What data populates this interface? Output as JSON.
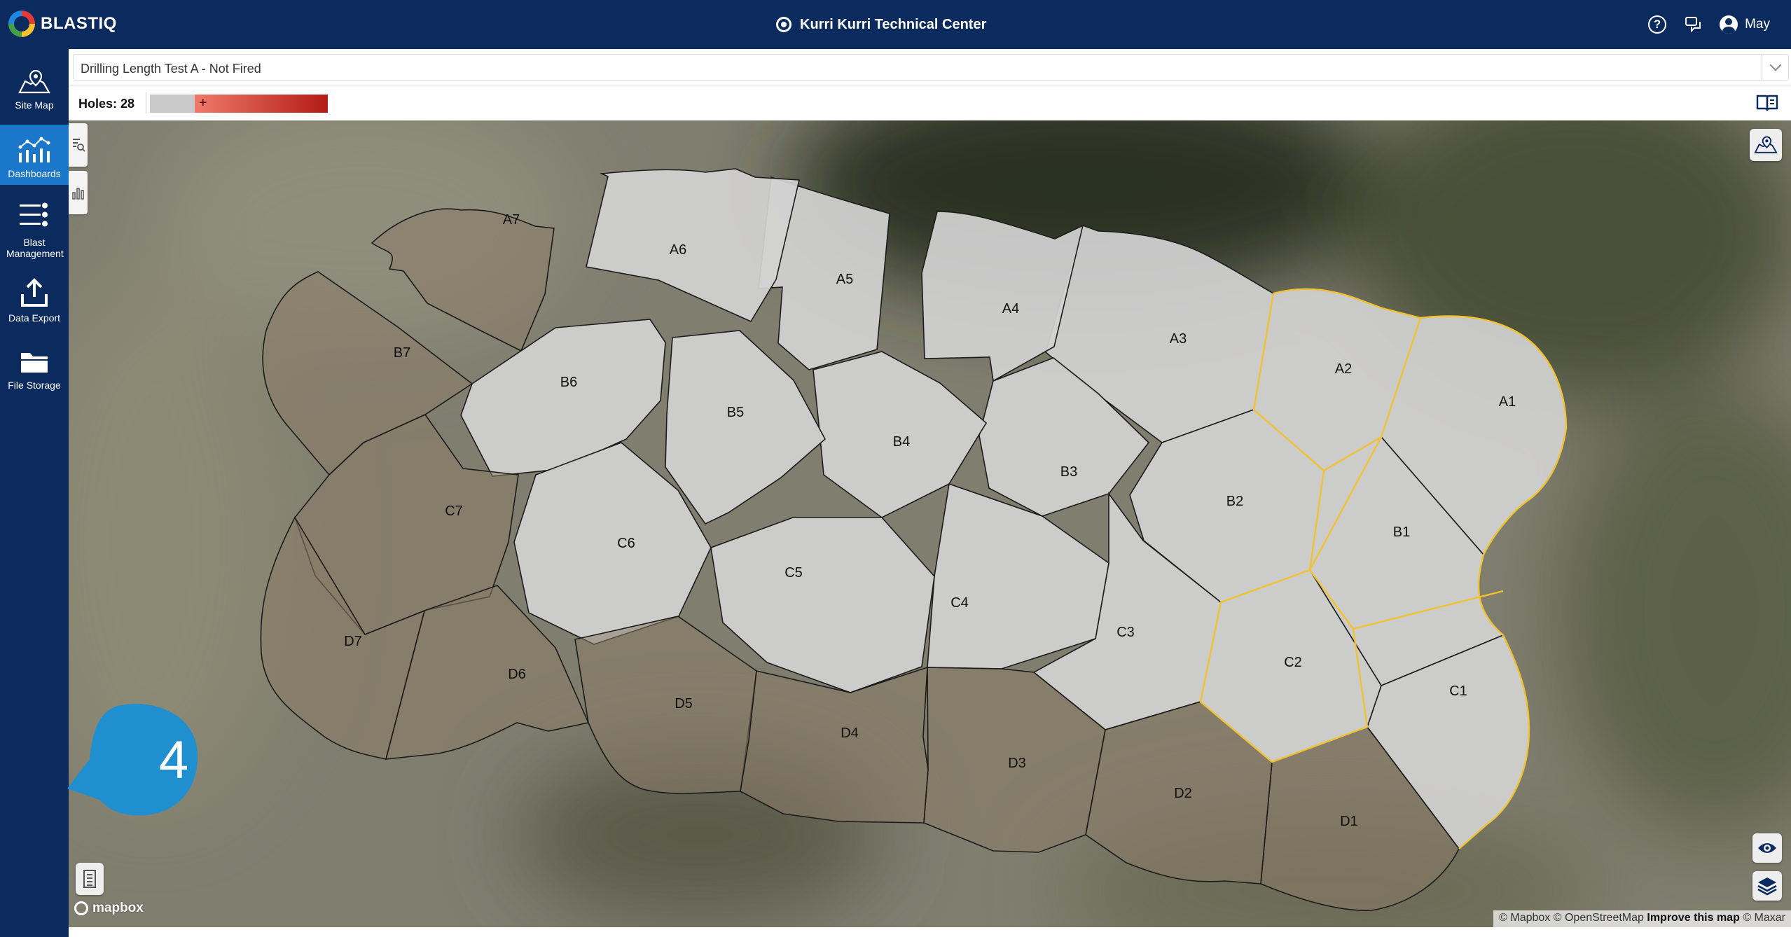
{
  "app": {
    "logo_text": "BLASTIQ",
    "site_name": "Kurri Kurri Technical Center",
    "user_name": "May"
  },
  "header_icons": [
    "help-icon",
    "chat-icon",
    "user-icon"
  ],
  "sidebar": {
    "items": [
      {
        "label": "Site Map",
        "icon": "map-pin-icon",
        "active": false
      },
      {
        "label": "Dashboards",
        "icon": "dashboard-icon",
        "active": true
      },
      {
        "label": "Blast Management",
        "icon": "blast-management-icon",
        "active": false
      },
      {
        "label": "Data Export",
        "icon": "upload-icon",
        "active": false
      },
      {
        "label": "File Storage",
        "icon": "folder-icon",
        "active": false
      }
    ]
  },
  "layer_select": {
    "value": "Drilling Length Test A - Not Fired"
  },
  "legend": {
    "holes_label": "Holes: 28",
    "ramp_plus": "+",
    "colors": {
      "no_data": "#c9c9c9",
      "low": "#ef7a6a",
      "high": "#b31b16"
    }
  },
  "map": {
    "cells": [
      {
        "id": "A1",
        "state": "in"
      },
      {
        "id": "A2",
        "state": "in"
      },
      {
        "id": "A3",
        "state": "in"
      },
      {
        "id": "A4",
        "state": "in"
      },
      {
        "id": "A5",
        "state": "in"
      },
      {
        "id": "A6",
        "state": "in"
      },
      {
        "id": "A7",
        "state": "out"
      },
      {
        "id": "B1",
        "state": "in"
      },
      {
        "id": "B2",
        "state": "in"
      },
      {
        "id": "B3",
        "state": "in"
      },
      {
        "id": "B4",
        "state": "in"
      },
      {
        "id": "B5",
        "state": "in"
      },
      {
        "id": "B6",
        "state": "in"
      },
      {
        "id": "B7",
        "state": "out"
      },
      {
        "id": "C1",
        "state": "in"
      },
      {
        "id": "C2",
        "state": "in"
      },
      {
        "id": "C3",
        "state": "in"
      },
      {
        "id": "C4",
        "state": "in"
      },
      {
        "id": "C5",
        "state": "in"
      },
      {
        "id": "C6",
        "state": "in"
      },
      {
        "id": "C7",
        "state": "out"
      },
      {
        "id": "D1",
        "state": "out"
      },
      {
        "id": "D2",
        "state": "out"
      },
      {
        "id": "D3",
        "state": "out"
      },
      {
        "id": "D4",
        "state": "out"
      },
      {
        "id": "D5",
        "state": "out"
      },
      {
        "id": "D6",
        "state": "out"
      },
      {
        "id": "D7",
        "state": "out"
      }
    ],
    "selected_cells": [
      "A1",
      "A2",
      "B1",
      "C1",
      "C2"
    ],
    "mapbox_label": "mapbox",
    "attribution": {
      "mapbox": "© Mapbox",
      "osm": "© OpenStreetMap",
      "improve": "Improve this map",
      "maxar": "© Maxar"
    },
    "outline_color": "#f1c232"
  },
  "step_callout": {
    "number": "4",
    "color": "#1f8fd0"
  }
}
